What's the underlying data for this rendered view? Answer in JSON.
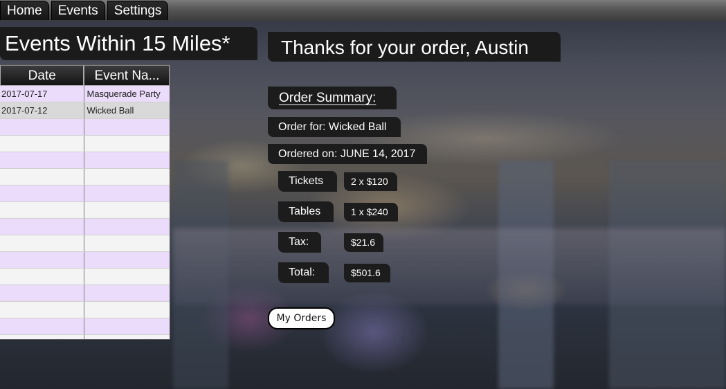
{
  "nav": {
    "items": [
      "Home",
      "Events",
      "Settings"
    ]
  },
  "events_panel": {
    "title": "Events Within 15 Miles*",
    "columns": [
      "Date",
      "Event Na..."
    ],
    "rows": [
      {
        "date": "2017-07-17",
        "name": "Masquerade Party"
      },
      {
        "date": "2017-07-12",
        "name": "Wicked Ball"
      }
    ]
  },
  "order": {
    "thanks": "Thanks for your order, Austin",
    "summary_header": "Order Summary:",
    "order_for": "Order for: Wicked Ball",
    "ordered_on": "Ordered on: JUNE 14, 2017",
    "tickets_label": "Tickets",
    "tickets_value": "2 x $120",
    "tables_label": "Tables",
    "tables_value": "1 x $240",
    "tax_label": "Tax:",
    "tax_value": "$21.6",
    "total_label": "Total:",
    "total_value": "$501.6",
    "my_orders_label": "My Orders"
  }
}
